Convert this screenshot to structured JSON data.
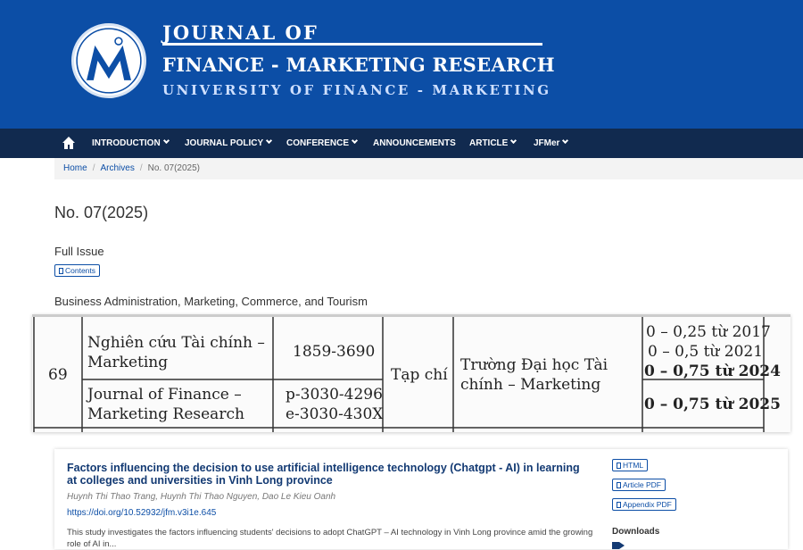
{
  "header": {
    "journal_line1": "JOURNAL OF",
    "journal_line2": "FINANCE - MARKETING RESEARCH",
    "journal_line3": "UNIVERSITY OF FINANCE - MARKETING",
    "brand_color": "#0c4ea6",
    "logo_icon": "university-logo"
  },
  "nav": {
    "home_icon": "home-icon",
    "items": [
      {
        "label": "INTRODUCTION",
        "dropdown": true
      },
      {
        "label": "JOURNAL POLICY",
        "dropdown": true
      },
      {
        "label": "CONFERENCE",
        "dropdown": true
      },
      {
        "label": "ANNOUNCEMENTS",
        "dropdown": false
      },
      {
        "label": "ARTICLE",
        "dropdown": true
      },
      {
        "label": "JFMer",
        "dropdown": true
      }
    ],
    "bar_color": "#112a4f"
  },
  "breadcrumb": {
    "home": "Home",
    "archives": "Archives",
    "current": "No. 07(2025)"
  },
  "issue": {
    "title": "No. 07(2025)",
    "full_issue_label": "Full Issue",
    "contents_button": "Contents",
    "section_title": "Business Administration, Marketing, Commerce, and Tourism"
  },
  "scan_table": {
    "row_number": "69",
    "name_1_line1": "Nghiên cứu Tài chính –",
    "name_1_line2": "Marketing",
    "issn_1": "1859-3690",
    "name_2_line1": "Journal of Finance –",
    "name_2_line2": "Marketing Research",
    "issn_2_print": "p-3030-4296",
    "issn_2_online": "e-3030-430X",
    "type": "Tạp chí",
    "publisher_line1": "Trường Đại học Tài",
    "publisher_line2": "chính – Marketing",
    "points_1": "0 – 0,25 từ 2017",
    "points_2": "0 – 0,5 từ 2021",
    "points_3": "0 – 0,75 từ 2024",
    "points_4": "0 – 0,75 từ 2025"
  },
  "article": {
    "title": "Factors influencing the decision to use artificial intelligence technology (Chatgpt - AI) in learning at colleges and universities in Vinh Long province",
    "authors": "Huynh Thi Thao Trang, Huynh Thi Thao Nguyen, Dao Le Kieu Oanh",
    "doi": "https://doi.org/10.52932/jfm.v3i1e.645",
    "abstract": "This study investigates the factors influencing students' decisions to adopt ChatGPT – AI technology in Vinh Long province amid the growing role of AI in...",
    "buttons": {
      "html": "HTML",
      "article_pdf": "Article PDF",
      "appendix_pdf": "Appendix PDF"
    },
    "downloads_label": "Downloads"
  }
}
